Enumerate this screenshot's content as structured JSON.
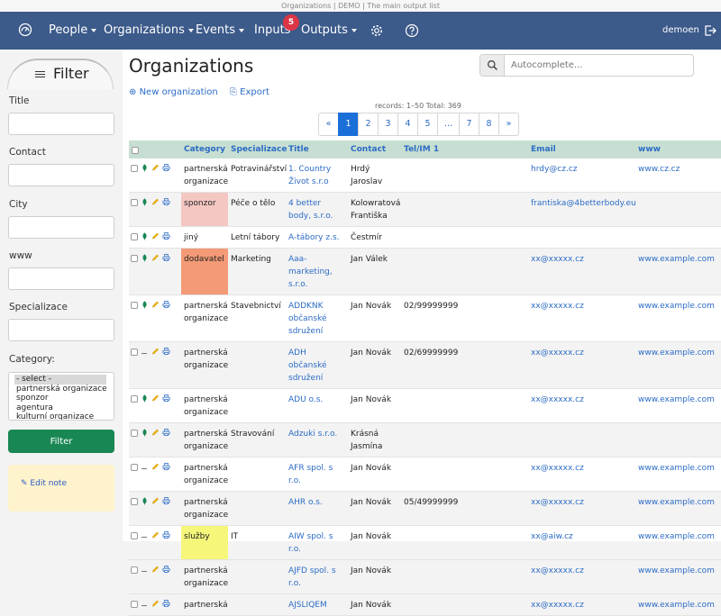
{
  "window": {
    "title": "Organizations | DEMO | The main output list"
  },
  "nav": {
    "brand_icon": "dashboard-gauge-icon",
    "items": [
      {
        "label": "People",
        "dropdown": true
      },
      {
        "label": "Organizations",
        "dropdown": true
      },
      {
        "label": "Events",
        "dropdown": true
      },
      {
        "label": "Inputs",
        "dropdown": false
      },
      {
        "label": "Outputs",
        "dropdown": true
      }
    ],
    "inputs_badge": "5",
    "settings_icon": "gear-icon",
    "help_icon": "help-circle-icon",
    "user": "demoen",
    "logout_icon": "logout-icon",
    "bg_color": "#3c5a8a"
  },
  "sidebar": {
    "filter_label": "Filter",
    "fields": [
      {
        "label": "Title",
        "value": ""
      },
      {
        "label": "Contact",
        "value": ""
      },
      {
        "label": "City",
        "value": ""
      },
      {
        "label": "www",
        "value": ""
      },
      {
        "label": "Specializace",
        "value": ""
      }
    ],
    "category_label": "Category:",
    "category_options": [
      "- select -",
      "partnerská organizace",
      "sponzor",
      "agentura",
      "kulturní organizace"
    ],
    "filter_button": "Filter",
    "edit_note": "Edit note"
  },
  "main": {
    "title": "Organizations",
    "search_placeholder": "Autocomplete...",
    "new_label": "New organization",
    "export_label": "Export",
    "records_text": "records: 1–50   Total: 369",
    "pagination": [
      "«",
      "1",
      "2",
      "3",
      "4",
      "5",
      "...",
      "7",
      "8",
      "»"
    ],
    "active_page": "1",
    "columns": [
      "Category",
      "Specializace",
      "Title",
      "Contact",
      "Tel/IM 1",
      "Email",
      "www"
    ],
    "rows": [
      {
        "status": "green",
        "category": "partnerská organizace",
        "cat_color": "",
        "spec": "Potravinářství",
        "title": "1. Country Život s.r.o",
        "contact": "Hrdý Jaroslav",
        "tel": "",
        "email": "hrdy@cz.cz",
        "www": "www.cz.cz"
      },
      {
        "status": "green",
        "category": "sponzor",
        "cat_color": "sponzor",
        "spec": "Péče o tělo",
        "title": "4 better body, s.r.o.",
        "contact": "Kolowratová Františka",
        "tel": "",
        "email": "frantiska@4betterbody.eu",
        "www": ""
      },
      {
        "status": "green",
        "category": "jiný",
        "cat_color": "",
        "spec": "Letní tábory",
        "title": "A-tábory z.s.",
        "contact": "Čestmír",
        "tel": "",
        "email": "",
        "www": ""
      },
      {
        "status": "green",
        "category": "dodavatel",
        "cat_color": "dodavatel",
        "spec": "Marketing",
        "title": "Aaa-marketing, s.r.o.",
        "contact": "Jan Válek",
        "tel": "",
        "email": "xx@xxxxx.cz",
        "www": "www.example.com"
      },
      {
        "status": "green",
        "category": "partnerská organizace",
        "cat_color": "",
        "spec": "Stavebnictví",
        "title": "ADDKNK občanské sdružení",
        "contact": "Jan Novák",
        "tel": "02/99999999",
        "email": "xx@xxxxx.cz",
        "www": "www.example.com"
      },
      {
        "status": "dash",
        "category": "partnerská organizace",
        "cat_color": "",
        "spec": "",
        "title": "ADH občanské sdružení",
        "contact": "Jan Novák",
        "tel": "02/69999999",
        "email": "xx@xxxxx.cz",
        "www": "www.example.com"
      },
      {
        "status": "green",
        "category": "partnerská organizace",
        "cat_color": "",
        "spec": "",
        "title": "ADU o.s.",
        "contact": "Jan Novák",
        "tel": "",
        "email": "xx@xxxxx.cz",
        "www": "www.example.com"
      },
      {
        "status": "green",
        "category": "partnerská organizace",
        "cat_color": "",
        "spec": "Stravování",
        "title": "Adzuki s.r.o.",
        "contact": "Krásná Jasmína",
        "tel": "",
        "email": "",
        "www": ""
      },
      {
        "status": "dash",
        "category": "partnerská organizace",
        "cat_color": "",
        "spec": "",
        "title": "AFR spol. s r.o.",
        "contact": "Jan Novák",
        "tel": "",
        "email": "xx@xxxxx.cz",
        "www": "www.example.com"
      },
      {
        "status": "green",
        "category": "partnerská organizace",
        "cat_color": "",
        "spec": "",
        "title": "AHR o.s.",
        "contact": "Jan Novák",
        "tel": "05/49999999",
        "email": "xx@xxxxx.cz",
        "www": "www.example.com"
      },
      {
        "status": "dash",
        "category": "služby",
        "cat_color": "sluzby",
        "spec": "IT",
        "title": "AIW spol. s r.o.",
        "contact": "Jan Novák",
        "tel": "",
        "email": "xx@aiw.cz",
        "www": "www.example.com"
      },
      {
        "status": "dash",
        "category": "partnerská organizace",
        "cat_color": "",
        "spec": "",
        "title": "AJFD spol. s r.o.",
        "contact": "Jan Novák",
        "tel": "",
        "email": "xx@xxxxx.cz",
        "www": "www.example.com"
      },
      {
        "status": "dash",
        "category": "partnerská",
        "cat_color": "",
        "spec": "",
        "title": "AJSLIQEM",
        "contact": "Jan Novák",
        "tel": "",
        "email": "xx@xxxxx.cz",
        "www": "www.example.com"
      }
    ],
    "category_colors": {
      "sponzor": "#f4c7c3",
      "dodavatel": "#f49a76",
      "sluzby": "#f5f67a"
    },
    "header_bg": "#c7dfd2",
    "link_color": "#2c6cc5"
  }
}
